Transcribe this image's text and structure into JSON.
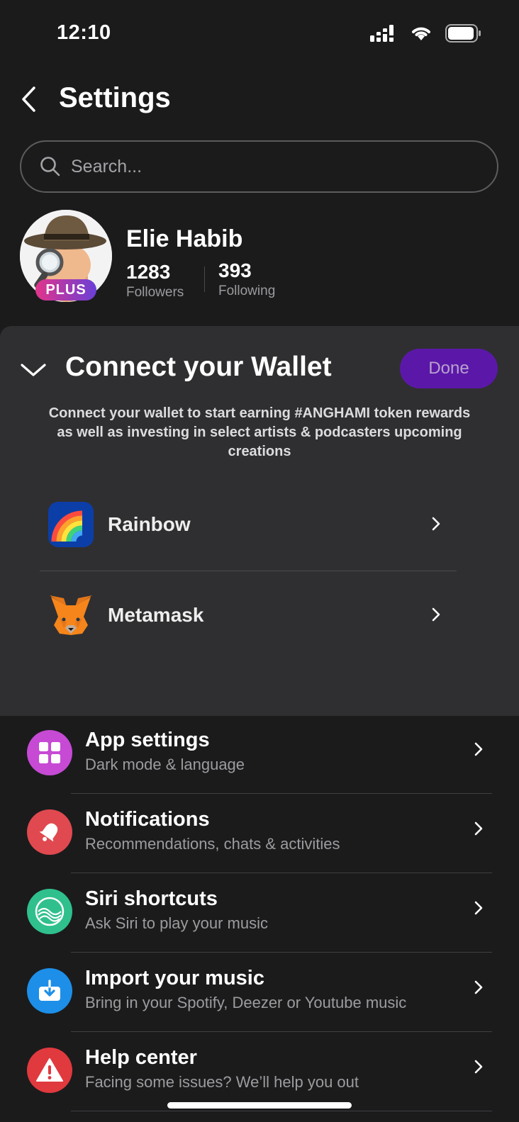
{
  "status_bar": {
    "time": "12:10",
    "icons": [
      "signal-icon",
      "wifi-icon",
      "battery-icon"
    ]
  },
  "nav": {
    "title": "Settings",
    "back_icon": "chevron-left-icon"
  },
  "search": {
    "placeholder": "Search...",
    "value": ""
  },
  "profile": {
    "name": "Elie Habib",
    "badge": "PLUS",
    "followers_count": "1283",
    "followers_label": "Followers",
    "following_count": "393",
    "following_label": "Following"
  },
  "wallet": {
    "title": "Connect your Wallet",
    "done_label": "Done",
    "description": "Connect your wallet to start earning #ANGHAMI token rewards as well as investing in select artists & podcasters upcoming creations",
    "options": [
      {
        "label": "Rainbow",
        "icon": "rainbow-icon"
      },
      {
        "label": "Metamask",
        "icon": "metamask-fox-icon"
      }
    ]
  },
  "settings": [
    {
      "title": "App settings",
      "subtitle": "Dark mode & language",
      "icon": "grid-icon",
      "color": "#c64ad4"
    },
    {
      "title": "Notifications",
      "subtitle": "Recommendations, chats & activities",
      "icon": "bell-icon",
      "color": "#e0494f"
    },
    {
      "title": "Siri shortcuts",
      "subtitle": "Ask Siri to play your music",
      "icon": "siri-waves-icon",
      "color": "#2fc08d"
    },
    {
      "title": "Import your music",
      "subtitle": "Bring in your Spotify, Deezer or Youtube music",
      "icon": "import-icon",
      "color": "#1d8fe8"
    },
    {
      "title": "Help center",
      "subtitle": "Facing some issues? We’ll help you out",
      "icon": "warning-icon",
      "color": "#e0393e"
    }
  ],
  "colors": {
    "background": "#1b1b1c",
    "panel": "#2f2f31",
    "accent": "#5b18a8"
  }
}
